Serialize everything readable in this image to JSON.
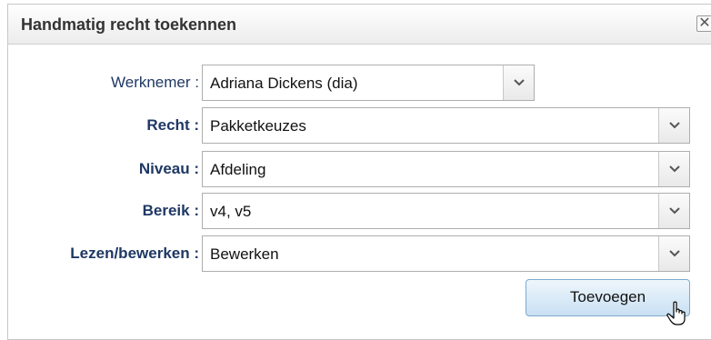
{
  "dialog": {
    "title": "Handmatig recht toekennen",
    "close_glyph": "✕",
    "icons": [
      "close-icon",
      "chevron-down-icon",
      "hand-pointer-icon"
    ]
  },
  "form": {
    "rows": [
      {
        "label": "Werknemer :",
        "value": "Adriana Dickens (dia)"
      },
      {
        "label": "Recht :",
        "value": "Pakketkeuzes"
      },
      {
        "label": "Niveau :",
        "value": "Afdeling"
      },
      {
        "label": "Bereik :",
        "value": "v4, v5"
      },
      {
        "label": "Lezen/bewerken :",
        "value": "Bewerken"
      }
    ],
    "submit_label": "Toevoegen"
  },
  "colors": {
    "label": "#1f3864",
    "button_border": "#7ea9cc",
    "button_fill": "#c9e0f3"
  }
}
